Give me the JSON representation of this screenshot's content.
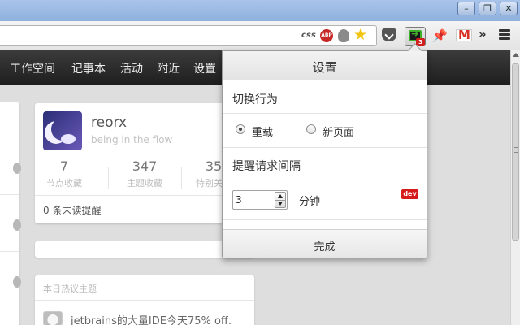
{
  "browser": {
    "window_buttons": [
      "–",
      "❐",
      "✕"
    ],
    "omnibox": {
      "css_label": "css",
      "abp_label": "ABP"
    },
    "extension_badge": "3"
  },
  "site_nav": {
    "items": [
      "工作空间",
      "记事本",
      "活动",
      "附近",
      "设置"
    ]
  },
  "profile": {
    "username": "reorx",
    "tagline": "being in the flow",
    "stats": [
      {
        "value": "7",
        "label": "节点收藏"
      },
      {
        "value": "347",
        "label": "主题收藏"
      },
      {
        "value": "35",
        "label": "特别关…"
      }
    ],
    "unread": "0 条未读提醒"
  },
  "hot_topics": {
    "title": "本日热议主题",
    "first_item": "jetbrains的大量IDE今天75% off."
  },
  "settings_popup": {
    "title": "设置",
    "switch_behavior": {
      "label": "切换行为",
      "options": [
        {
          "label": "重载",
          "checked": true
        },
        {
          "label": "新页面",
          "checked": false
        }
      ]
    },
    "interval": {
      "label": "提醒请求间隔",
      "value": "3",
      "unit": "分钟"
    },
    "dev_badge": "dev",
    "done_label": "完成"
  }
}
